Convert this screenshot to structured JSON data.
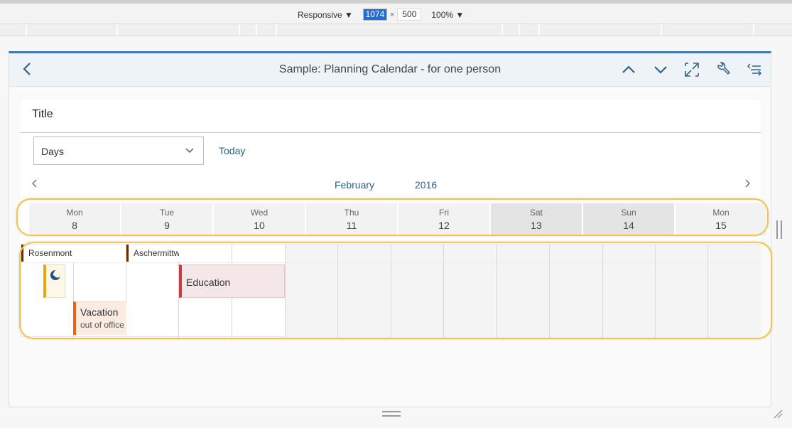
{
  "devtools": {
    "mode": "Responsive",
    "width": "1074",
    "separator": "×",
    "height": "500",
    "zoom": "100%"
  },
  "shell": {
    "title": "Sample: Planning Calendar - for one person",
    "icons": [
      "back-icon",
      "chevron-up-icon",
      "chevron-down-icon",
      "fullscreen-icon",
      "wrench-icon",
      "settings-list-icon"
    ]
  },
  "calendar": {
    "title": "Title",
    "view_select": "Days",
    "today_label": "Today",
    "month": "February",
    "year": "2016",
    "days": [
      {
        "name": "Mon",
        "date": "8"
      },
      {
        "name": "Tue",
        "date": "9"
      },
      {
        "name": "Wed",
        "date": "10"
      },
      {
        "name": "Thu",
        "date": "11"
      },
      {
        "name": "Fri",
        "date": "12"
      },
      {
        "name": "Sat",
        "date": "13"
      },
      {
        "name": "Sun",
        "date": "14"
      },
      {
        "name": "Mon",
        "date": "15"
      }
    ],
    "markers": [
      {
        "label": "Rosenmont"
      },
      {
        "label": "Aschermittw"
      }
    ],
    "appointments": [
      {
        "title": "Education"
      },
      {
        "title": "Vacation",
        "text": "out of office"
      }
    ]
  },
  "colors": {
    "accent": "#346187",
    "education": "#c2403f",
    "vacation": "#e0661b",
    "icon_appt": "#e3a51a",
    "highlight": "#f1c54a"
  }
}
